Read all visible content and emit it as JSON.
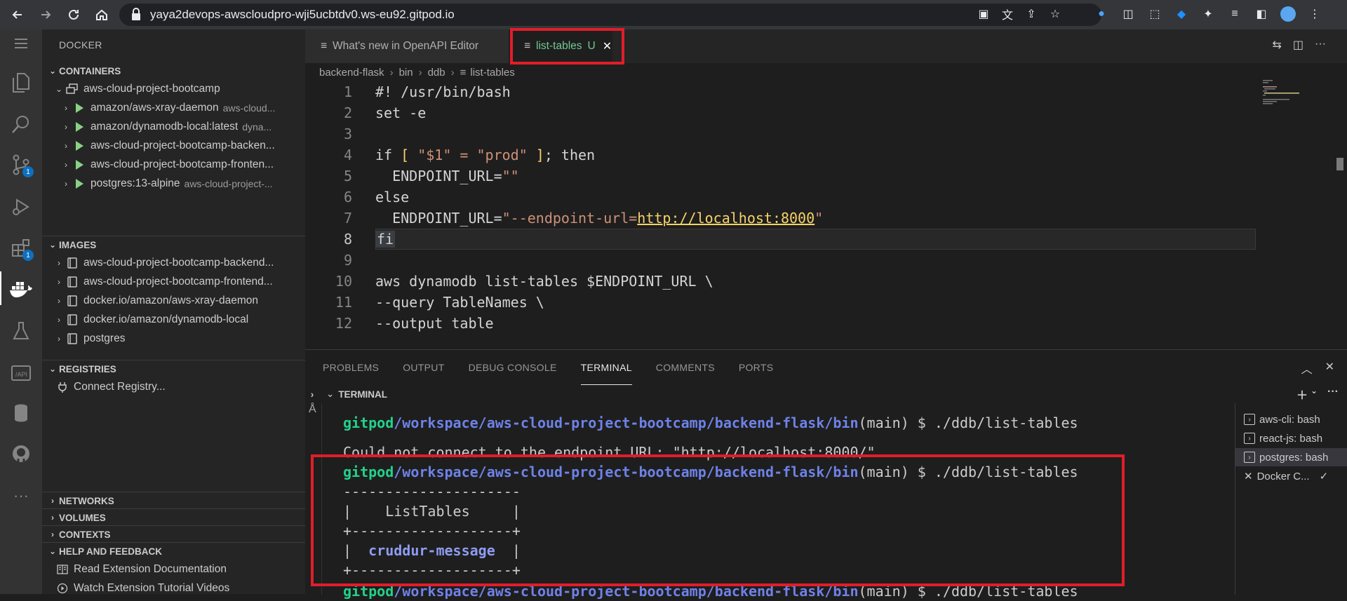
{
  "browser": {
    "url": "yaya2devops-awscloudpro-wji5ucbtdv0.ws-eu92.gitpod.io"
  },
  "sidebar": {
    "title": "DOCKER",
    "containers": {
      "header": "CONTAINERS",
      "group": "aws-cloud-project-bootcamp",
      "items": [
        {
          "name": "amazon/aws-xray-daemon",
          "desc": "aws-cloud..."
        },
        {
          "name": "amazon/dynamodb-local:latest",
          "desc": "dyna..."
        },
        {
          "name": "aws-cloud-project-bootcamp-backen...",
          "desc": ""
        },
        {
          "name": "aws-cloud-project-bootcamp-fronten...",
          "desc": ""
        },
        {
          "name": "postgres:13-alpine",
          "desc": "aws-cloud-project-..."
        }
      ]
    },
    "images": {
      "header": "IMAGES",
      "items": [
        "aws-cloud-project-bootcamp-backend...",
        "aws-cloud-project-bootcamp-frontend...",
        "docker.io/amazon/aws-xray-daemon",
        "docker.io/amazon/dynamodb-local",
        "postgres"
      ]
    },
    "registries": {
      "header": "REGISTRIES",
      "connect": "Connect Registry..."
    },
    "networks": "NETWORKS",
    "volumes": "VOLUMES",
    "contexts": "CONTEXTS",
    "help": {
      "header": "HELP AND FEEDBACK",
      "items": [
        "Read Extension Documentation",
        "Watch Extension Tutorial Videos"
      ]
    }
  },
  "activity": {
    "scm_badge": "1",
    "ext_badge": "1"
  },
  "tabs": {
    "tab1": "What's new in OpenAPI Editor",
    "tab2": "list-tables",
    "tab2_status": "U"
  },
  "breadcrumb": [
    "backend-flask",
    "bin",
    "ddb",
    "list-tables"
  ],
  "code": {
    "lines": [
      {
        "n": "1",
        "text": "#! /usr/bin/bash"
      },
      {
        "n": "2",
        "text": "set -e"
      },
      {
        "n": "3",
        "text": ""
      },
      {
        "n": "4",
        "pre": "if ",
        "br1": "[",
        "mid": " \"$1\" = \"prod\" ",
        "br2": "]",
        "post": "; then"
      },
      {
        "n": "5",
        "pre": "  ENDPOINT_URL=",
        "str": "\"\""
      },
      {
        "n": "6",
        "text": "else"
      },
      {
        "n": "7",
        "pre": "  ENDPOINT_URL=",
        "str1": "\"--endpoint-url=",
        "link": "http://localhost:8000",
        "str2": "\""
      },
      {
        "n": "8",
        "text": "fi"
      },
      {
        "n": "9",
        "text": ""
      },
      {
        "n": "10",
        "text": "aws dynamodb list-tables $ENDPOINT_URL \\"
      },
      {
        "n": "11",
        "text": "--query TableNames \\"
      },
      {
        "n": "12",
        "text": "--output table"
      }
    ]
  },
  "panel": {
    "tabs": [
      "PROBLEMS",
      "OUTPUT",
      "DEBUG CONSOLE",
      "TERMINAL",
      "COMMENTS",
      "PORTS"
    ],
    "terminal_header": "TERMINAL"
  },
  "terminal": {
    "user": "gitpod",
    "path": "/workspace/aws-cloud-project-bootcamp/backend-flask/bin",
    "branch": "(main) $ ./ddb/list-tables",
    "error": "Could not connect to the endpoint URL: \"http://localhost:8000/\"",
    "border1": "---------------------",
    "title_row": "|    ListTables     |",
    "border2": "+-------------------+",
    "row_pre": "|  ",
    "row_val": "cruddur-message",
    "row_post": "  |",
    "border3": "+-------------------+"
  },
  "terminal_list": [
    "aws-cli: bash",
    "react-js: bash",
    "postgres: bash",
    "Docker C..."
  ]
}
